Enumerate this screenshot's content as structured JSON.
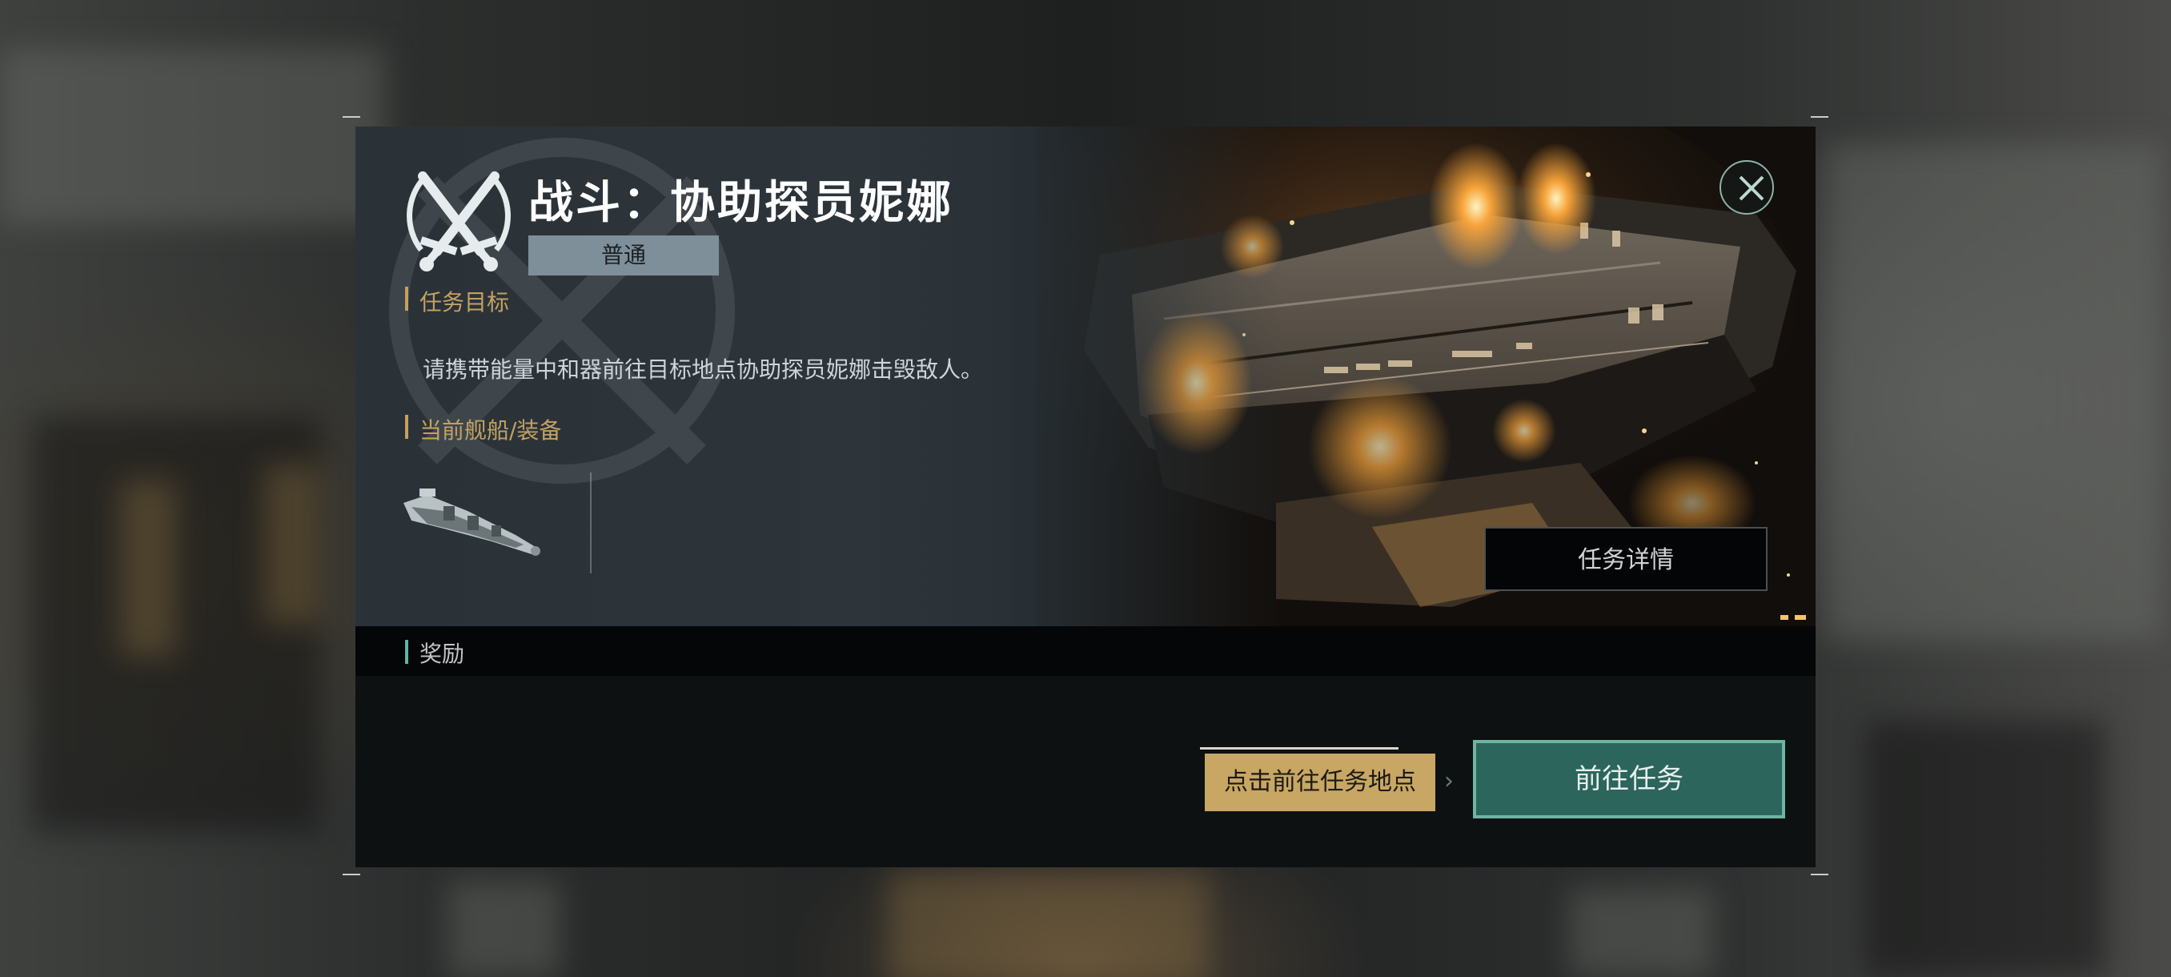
{
  "mission": {
    "title": "战斗：协助探员妮娜",
    "difficulty": "普通",
    "objective_label": "任务目标",
    "objective_text": "请携带能量中和器前往目标地点协助探员妮娜击毁敌人。",
    "equipment_label": "当前舰船/装备",
    "equipment_icon": "warship-icon",
    "details_button": "任务详情",
    "reward_label": "奖励",
    "hint_text": "点击前往任务地点",
    "go_button": "前往任务"
  },
  "colors": {
    "accent_gold": "#c4a062",
    "accent_teal": "#2b655c",
    "teal_border": "#6fb3a3",
    "panel_dark": "#0e1112"
  }
}
